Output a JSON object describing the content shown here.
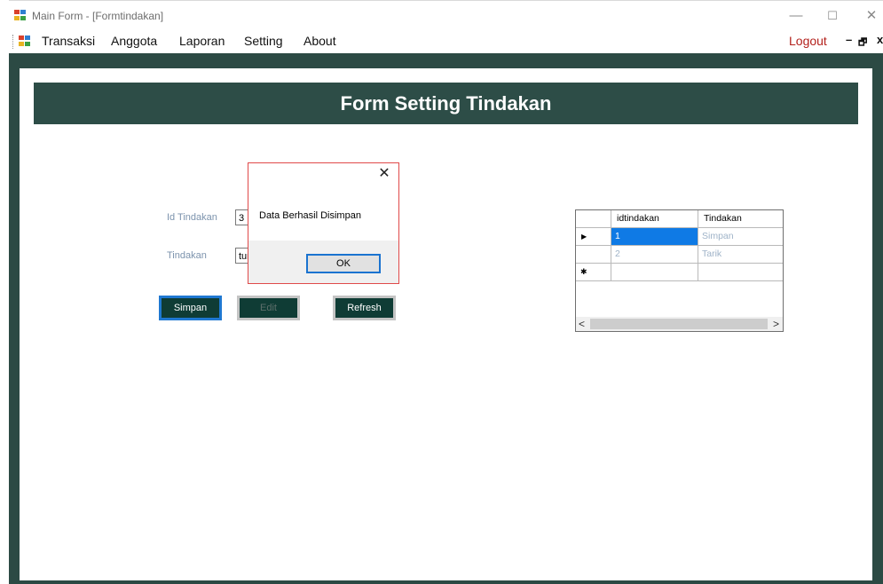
{
  "window": {
    "title": "Main Form - [Formtindakan]",
    "controls": {
      "minimize": "—",
      "maximize": "☐",
      "close": "✕"
    }
  },
  "menu": {
    "items": [
      "Transaksi",
      "Anggota",
      "Laporan",
      "Setting",
      "About"
    ],
    "logout": "Logout",
    "mdi_controls": {
      "minimize": "–",
      "restore": "🗗",
      "close": "x"
    }
  },
  "form": {
    "header": "Form Setting Tindakan",
    "fields": {
      "id_label": "Id Tindakan",
      "id_value": "3",
      "tindakan_label": "Tindakan",
      "tindakan_value": "tur"
    },
    "buttons": {
      "simpan": "Simpan",
      "edit": "Edit",
      "refresh": "Refresh"
    }
  },
  "grid": {
    "columns": [
      "idtindakan",
      "Tindakan"
    ],
    "rows": [
      {
        "indicator": "▶",
        "idtindakan": "1",
        "tindakan": "Simpan"
      },
      {
        "indicator": "",
        "idtindakan": "2",
        "tindakan": "Tarik"
      },
      {
        "indicator": "✱",
        "idtindakan": "",
        "tindakan": ""
      }
    ],
    "scroll_left": "<",
    "scroll_right": ">"
  },
  "dialog": {
    "message": "Data Berhasil Disimpan",
    "ok_label": "OK",
    "close": "✕"
  },
  "colors": {
    "frame": "#2c4a44",
    "header_band": "#2d4d47",
    "button": "#0f3c35",
    "logout": "#b3211c",
    "selection": "#0f7ae5",
    "label": "#7c93ad"
  }
}
